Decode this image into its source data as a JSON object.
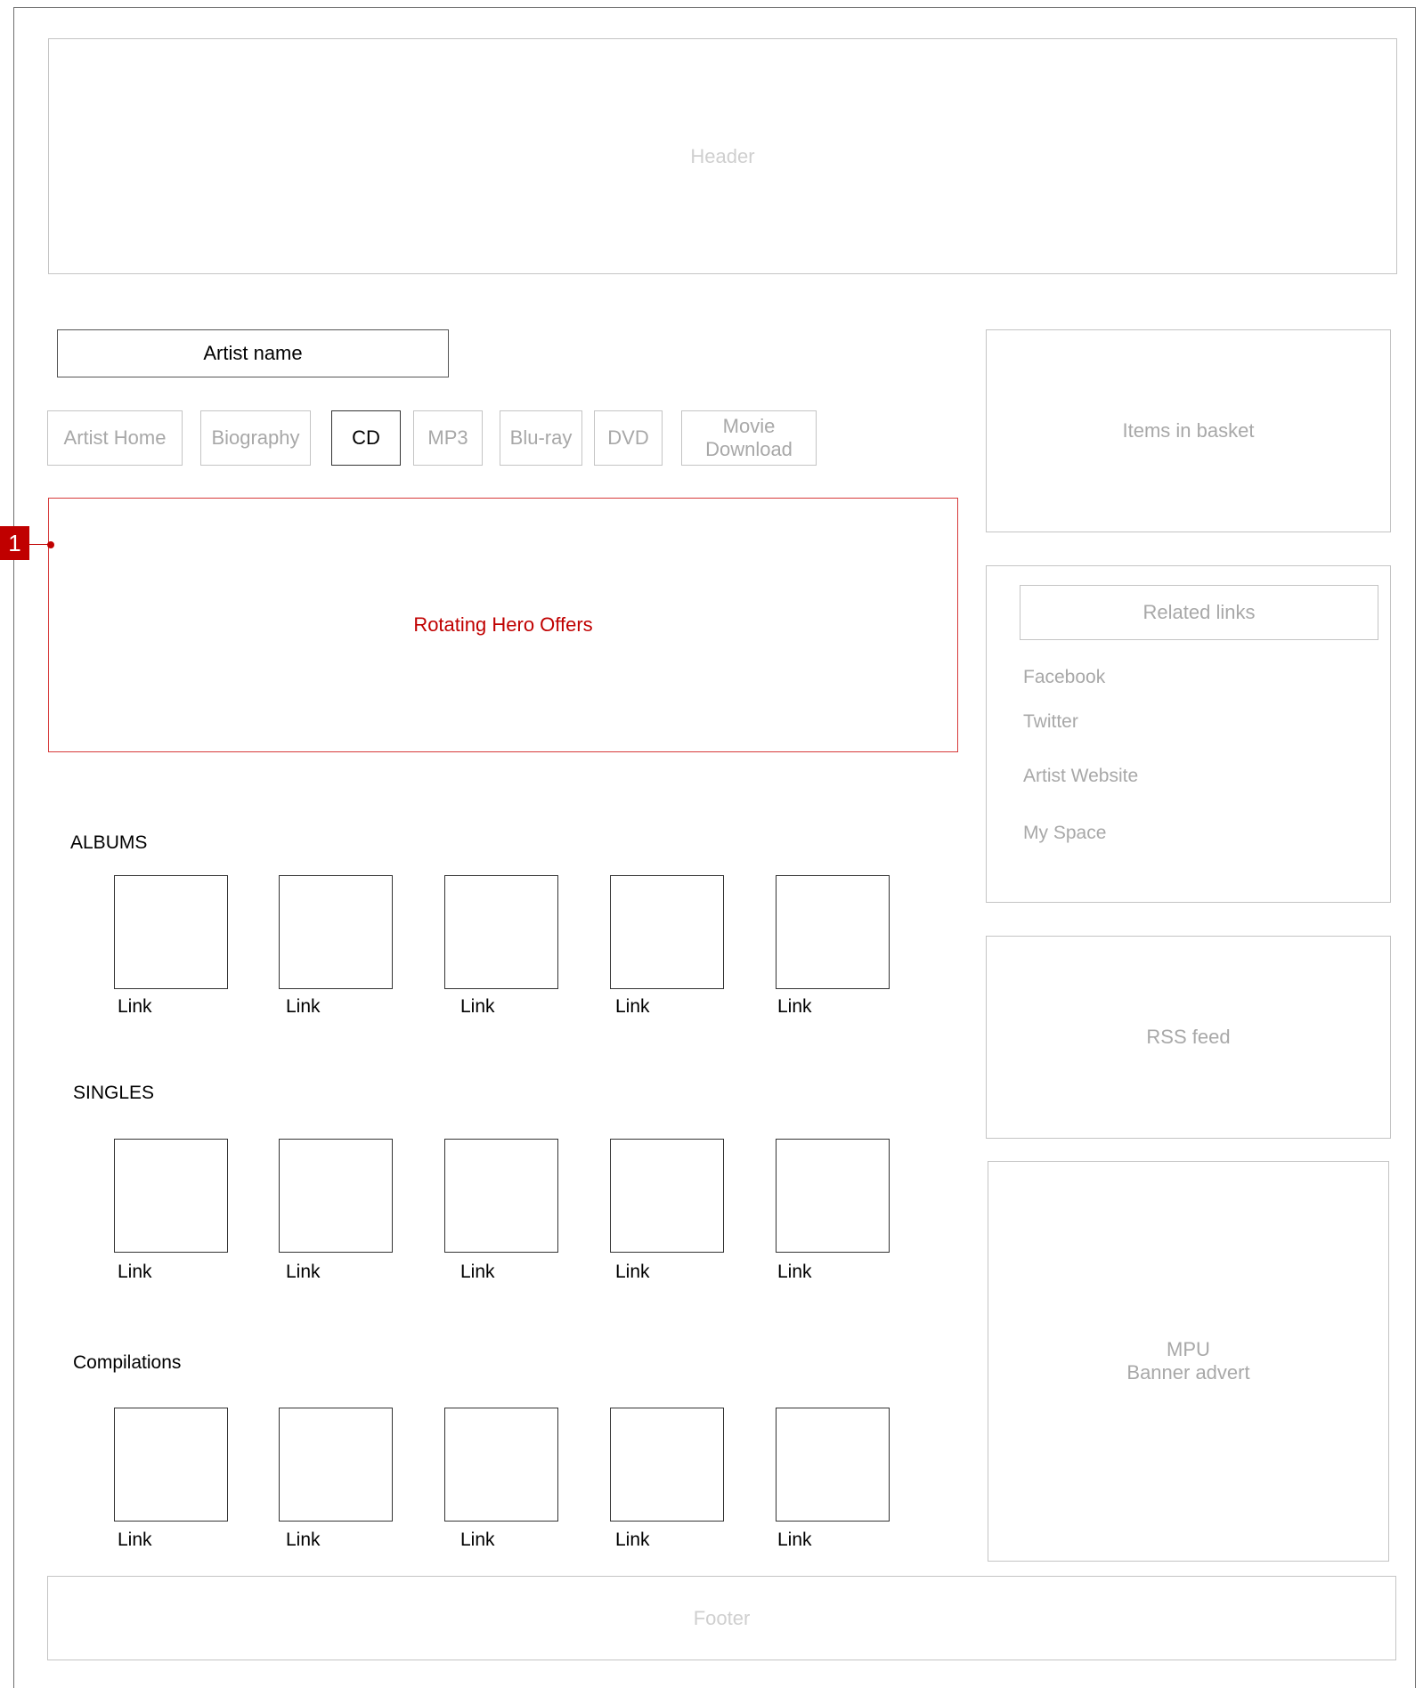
{
  "header": {
    "label": "Header"
  },
  "footer": {
    "label": "Footer"
  },
  "artist": {
    "name": "Artist name"
  },
  "tabs": [
    {
      "label": "Artist Home",
      "active": false
    },
    {
      "label": "Biography",
      "active": false
    },
    {
      "label": "CD",
      "active": true
    },
    {
      "label": "MP3",
      "active": false
    },
    {
      "label": "Blu-ray",
      "active": false
    },
    {
      "label": "DVD",
      "active": false
    },
    {
      "label": "Movie Download",
      "line1": "Movie",
      "line2": "Download",
      "active": false
    }
  ],
  "hero": {
    "label": "Rotating Hero Offers",
    "marker": "1"
  },
  "sections": [
    {
      "title": "ALBUMS",
      "items": [
        "Link",
        "Link",
        "Link",
        "Link",
        "Link"
      ]
    },
    {
      "title": "SINGLES",
      "items": [
        "Link",
        "Link",
        "Link",
        "Link",
        "Link"
      ]
    },
    {
      "title": "Compilations",
      "items": [
        "Link",
        "Link",
        "Link",
        "Link",
        "Link"
      ]
    }
  ],
  "sidebar": {
    "basket": "Items in basket",
    "related": {
      "title": "Related links",
      "links": [
        "Facebook",
        "Twitter",
        "Artist Website",
        "My Space"
      ]
    },
    "rss": "RSS feed",
    "mpu": {
      "line1": "MPU",
      "line2": "Banner advert"
    }
  },
  "colors": {
    "accent": "#c00000",
    "box_border": "#c4c4c4",
    "muted_text": "#a8a8a8"
  }
}
